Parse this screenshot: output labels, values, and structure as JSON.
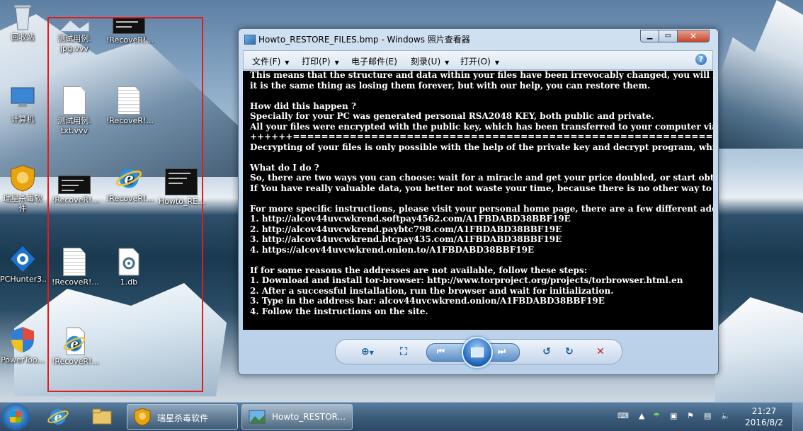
{
  "desktop": {
    "icons": [
      {
        "label": "回收站",
        "icon": "recycle-bin-icon"
      },
      {
        "label": "计算机",
        "icon": "computer-icon"
      },
      {
        "label": "瑞星杀毒软\n件",
        "icon": "rising-antivirus-icon"
      },
      {
        "label": "PCHunter3...",
        "icon": "pchunter-icon"
      },
      {
        "label": "PowerToo...",
        "icon": "powertool-shield-icon"
      },
      {
        "label": "测试用例.\njpg.vvv",
        "icon": "encrypted-image-icon"
      },
      {
        "label": "!RecoveR!...",
        "icon": "recover-note-image-icon"
      },
      {
        "label": "测试用例.\ntxt.vvv",
        "icon": "encrypted-document-icon"
      },
      {
        "label": "!RecoveR!...",
        "icon": "recover-note-text-icon"
      },
      {
        "label": "!RecoveR!...",
        "icon": "recover-note-image-icon"
      },
      {
        "label": "!RecoveR!...",
        "icon": "recover-note-html-icon"
      },
      {
        "label": "Howto_RE...",
        "icon": "howto-restore-image-icon"
      },
      {
        "label": "!RecoveR!...",
        "icon": "recover-note-text-icon"
      },
      {
        "label": "1.db",
        "icon": "db-file-icon"
      },
      {
        "label": "!RecoveR!...",
        "icon": "recover-note-html-icon"
      }
    ]
  },
  "viewer": {
    "title": "Howto_RESTORE_FILES.bmp - Windows 照片查看器",
    "menu": [
      {
        "label": "文件(F)",
        "has_dropdown": true
      },
      {
        "label": "打印(P)",
        "has_dropdown": true
      },
      {
        "label": "电子邮件(E)",
        "has_dropdown": false
      },
      {
        "label": "刻录(U)",
        "has_dropdown": true
      },
      {
        "label": "打开(O)",
        "has_dropdown": true
      }
    ],
    "help_label": "?",
    "image_text_lines": [
      "This means that the structure and data within your files have been irrevocably changed, you will not be able t",
      "it is the same thing as losing them forever, but with our help, you can restore them.",
      "",
      "How did this happen ?",
      "Specially for your PC was generated personal RSA2048 KEY, both public and private.",
      "All your files were encrypted with the public key, which has been transferred to your computer via the Intern",
      "++++++===========================================================================================",
      "Decrypting of your files is only possible with the help of the private key and decrypt program, which is on our",
      "",
      "What do I do ?",
      "So, there are two ways you can choose: wait for a miracle and get your price doubled, or start obtaining BTC I",
      "If You have really valuable data, you better not waste your time, because there is no other way to get your fi",
      "",
      "For more specific instructions, please visit your personal home page, there are a few different addresses poi",
      "1. http://alcov44uvcwkrend.softpay4562.com/A1FBDABD38BBF19E",
      "2. http://alcov44uvcwkrend.paybtc798.com/A1FBDABD38BBF19E",
      "3. http://alcov44uvcwkrend.btcpay435.com/A1FBDABD38BBF19E",
      "4. https://alcov44uvcwkrend.onion.to/A1FBDABD38BBF19E",
      "",
      "If for some reasons the addresses are not available, follow these steps:",
      "1. Download and install tor-browser: http://www.torproject.org/projects/torbrowser.html.en",
      "2. After a successful installation, run the browser and wait for initialization.",
      "3. Type in the address bar: alcov44uvcwkrend.onion/A1FBDABD38BBF19E",
      "4. Follow the instructions on the site."
    ],
    "controls": [
      "zoom-icon",
      "fit-to-window-icon",
      "previous-icon",
      "slideshow-icon",
      "next-icon",
      "rotate-ccw-icon",
      "rotate-cw-icon",
      "delete-icon"
    ]
  },
  "taskbar": {
    "tasks": [
      {
        "label": "瑞星杀毒软件",
        "icon": "rising-antivirus-icon"
      },
      {
        "label": "Howto_RESTOR...",
        "icon": "photo-viewer-icon"
      }
    ],
    "clock": {
      "time": "21:27",
      "date": "2016/8/2"
    }
  },
  "colors": {
    "selection_border": "#e21c1c",
    "window_frame": "#b9d0e8",
    "viewer_bg": "#000000"
  }
}
